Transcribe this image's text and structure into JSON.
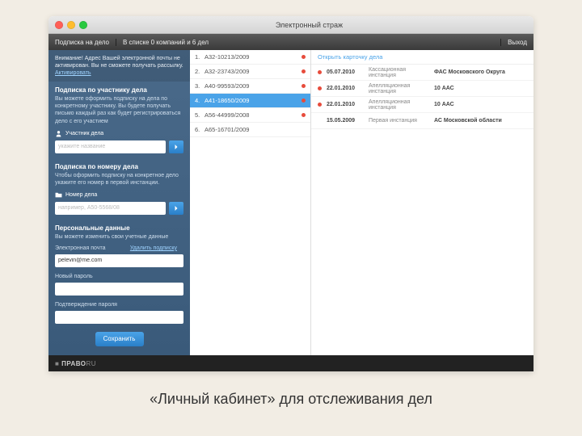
{
  "window": {
    "title": "Электронный страж"
  },
  "menubar": {
    "left": "Подписка на дело",
    "mid": "В списке 0 компаний и 6 дел",
    "right": "Выход"
  },
  "sidebar": {
    "warn_text": "Внимание! Адрес Вашей электронной почты не активирован. Вы не сможете получать рассылку.",
    "warn_link": "Активировать",
    "section1": {
      "title": "Подписка по участнику дела",
      "desc": "Вы можете оформить подписку на дела по конкретному участнику. Вы будете получать письмо каждый раз как будет регистрироваться дело с его участием",
      "label": "Участник дела",
      "placeholder": "укажите название"
    },
    "section2": {
      "title": "Подписка по номеру дела",
      "desc": "Чтобы оформить подписку на конкретное дело укажите его номер в первой инстанции.",
      "label": "Номер дела",
      "placeholder": "например, А50-5568/08"
    },
    "section3": {
      "title": "Персональные данные",
      "desc": "Вы можете изменить свои учетные данные",
      "email_label": "Электронная почта",
      "delete_link": "Удалить подписку",
      "email_value": "pelevin@me.com",
      "pass1_label": "Новый пароль",
      "pass2_label": "Подтверждение пароля",
      "save": "Сохранить"
    }
  },
  "cases": [
    {
      "n": "1.",
      "code": "А32-10213/2009",
      "dot": true
    },
    {
      "n": "2.",
      "code": "А32-23743/2009",
      "dot": true
    },
    {
      "n": "3.",
      "code": "А40-99593/2009",
      "dot": true
    },
    {
      "n": "4.",
      "code": "А41-18650/2009",
      "dot": true,
      "selected": true
    },
    {
      "n": "5.",
      "code": "А56-44999/2008",
      "dot": true
    },
    {
      "n": "6.",
      "code": "А65-16701/2009",
      "dot": false
    }
  ],
  "detail": {
    "open": "Открыть карточку дела",
    "rows": [
      {
        "dot": true,
        "date": "05.07.2010",
        "inst": "Кассационная инстанция",
        "court": "ФАС Московского Округа"
      },
      {
        "dot": true,
        "date": "22.01.2010",
        "inst": "Апелляционная инстанция",
        "court": "10 ААС"
      },
      {
        "dot": true,
        "date": "22.01.2010",
        "inst": "Апелляционная инстанция",
        "court": "10 ААС"
      },
      {
        "dot": false,
        "date": "15.05.2009",
        "inst": "Первая инстанция",
        "court": "АС Московской области"
      }
    ]
  },
  "footer": {
    "logo_prefix": "■ ",
    "logo_bold": "ПРАВО",
    "logo_suffix": "RU"
  },
  "caption": "«Личный кабинет» для отслеживания дел"
}
